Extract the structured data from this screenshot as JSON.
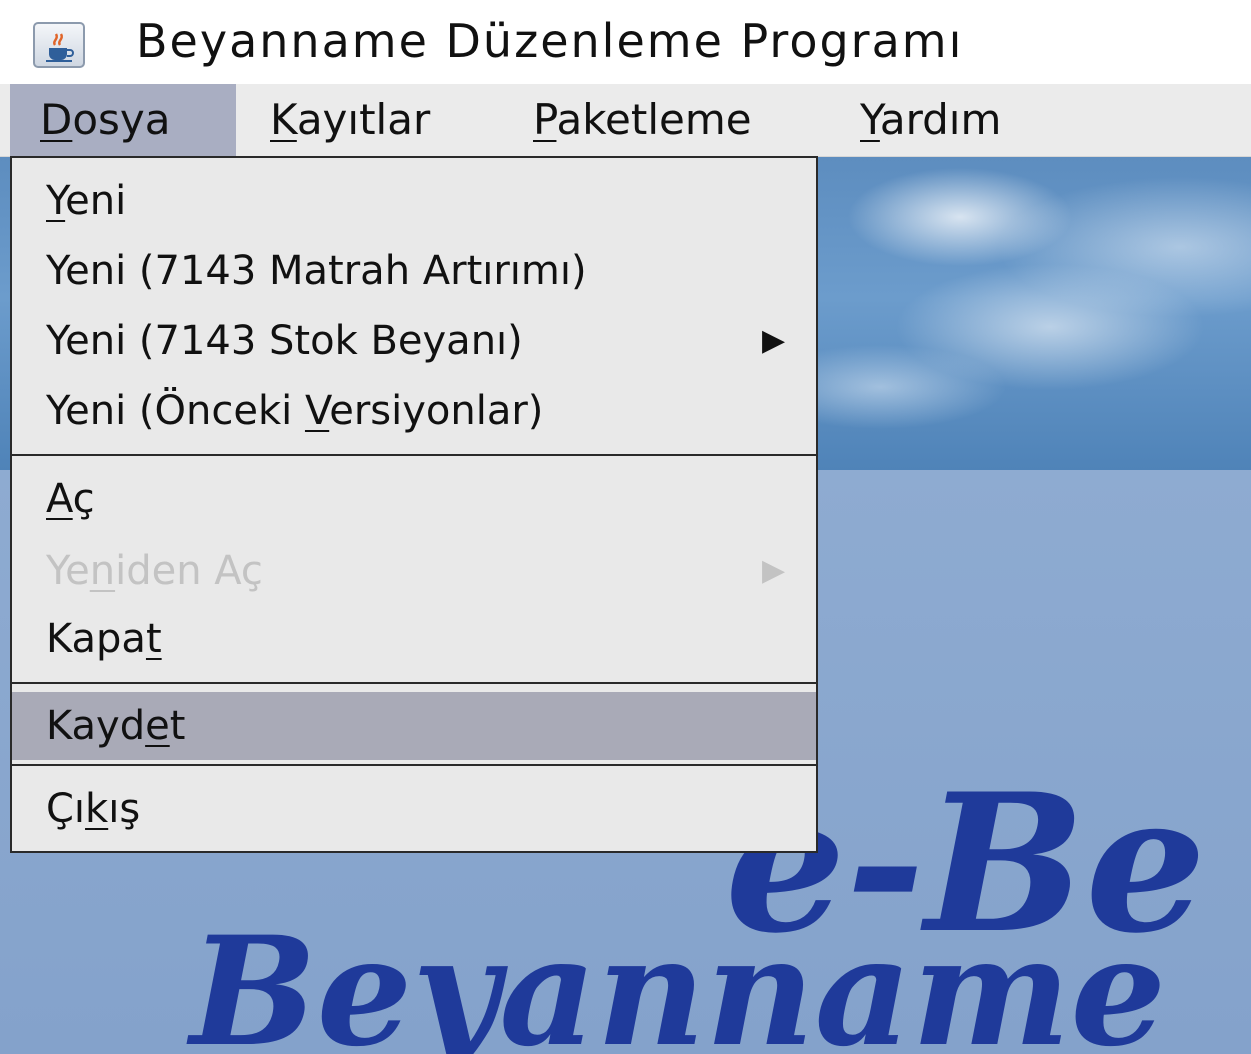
{
  "window": {
    "title": "Beyanname Düzenleme Programı"
  },
  "menubar": {
    "items": [
      {
        "pre": "",
        "mn": "D",
        "post": "osya"
      },
      {
        "pre": "",
        "mn": "K",
        "post": "ayıtlar"
      },
      {
        "pre": "",
        "mn": "P",
        "post": "aketleme"
      },
      {
        "pre": "",
        "mn": "Y",
        "post": "ardım"
      }
    ]
  },
  "dropdown": {
    "items": [
      {
        "pre": "",
        "mn": "Y",
        "post": "eni"
      },
      {
        "pre": "Yeni (7143 Matrah Artırımı)",
        "mn": "",
        "post": ""
      },
      {
        "pre": "Yeni (7143 Stok Beyanı)",
        "mn": "",
        "post": "",
        "arrow": "▶"
      },
      {
        "pre": "Yeni (Önceki ",
        "mn": "V",
        "post": "ersiyonlar)"
      },
      {
        "pre": "",
        "mn": "A",
        "post": "ç"
      },
      {
        "pre": "Ye",
        "mn": "n",
        "post": "iden Aç",
        "arrow": "▶"
      },
      {
        "pre": "Kapa",
        "mn": "t",
        "post": ""
      },
      {
        "pre": "Kayd",
        "mn": "e",
        "post": "t"
      },
      {
        "pre": "Çı",
        "mn": "k",
        "post": "ış"
      }
    ]
  },
  "background": {
    "brand_main": "e-Be",
    "brand_sub": "Beyanname"
  },
  "colors": {
    "menu_highlight": "#a9aab7",
    "menubar_active": "#a9aec2",
    "brand_blue": "#1f3a9a",
    "disabled_text": "#c3c3c3"
  },
  "icons": {
    "app_icon": "java-cup-icon",
    "submenu_arrow": "triangle-right-icon"
  }
}
